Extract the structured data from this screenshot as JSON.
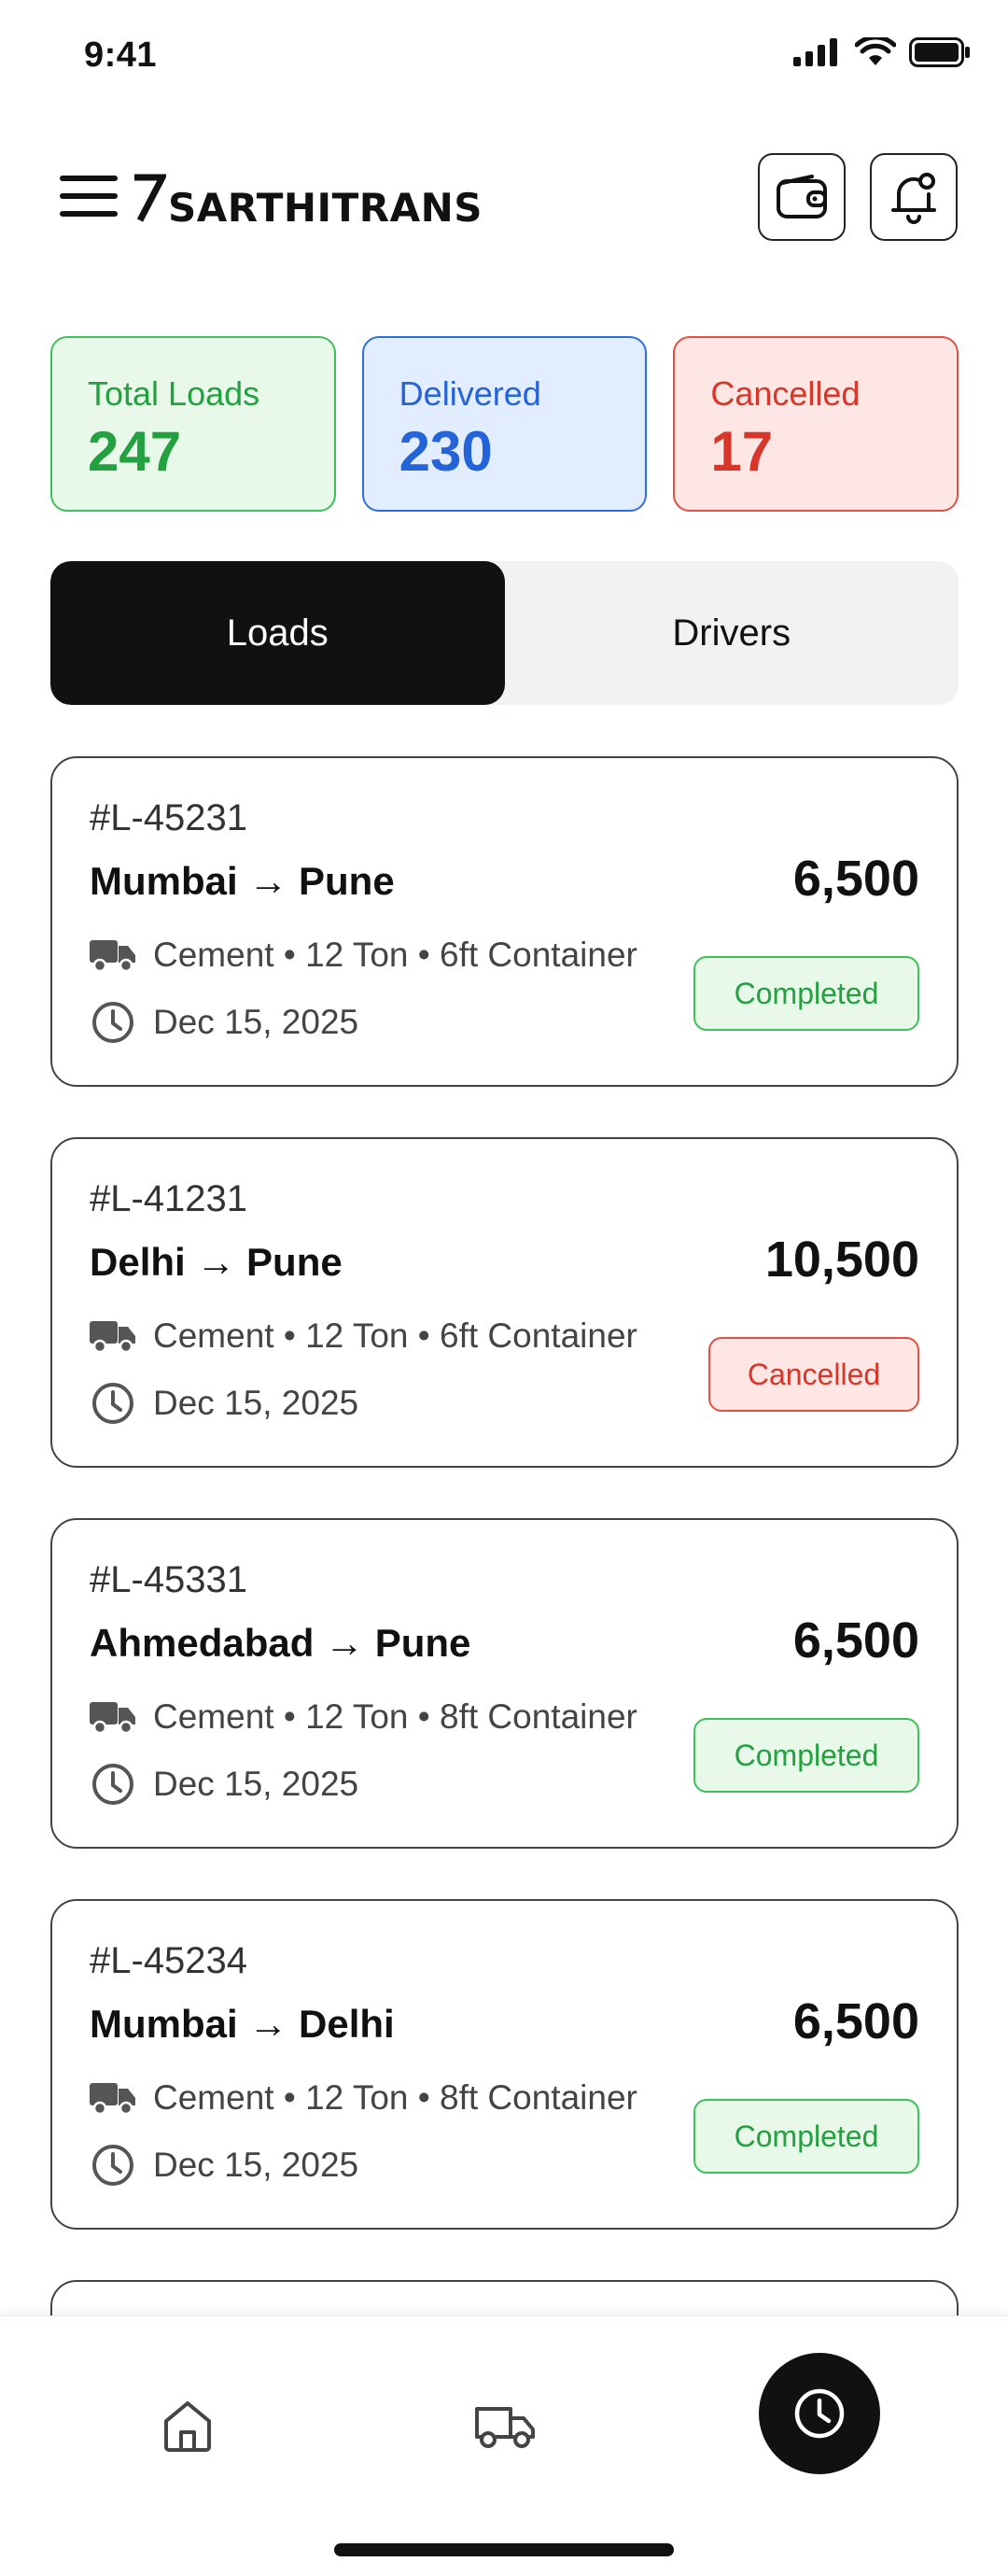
{
  "status_bar": {
    "time": "9:41"
  },
  "header": {
    "brand": "SARTHITRANS"
  },
  "stats": [
    {
      "label": "Total Loads",
      "value": "247"
    },
    {
      "label": "Delivered",
      "value": "230"
    },
    {
      "label": "Cancelled",
      "value": "17"
    }
  ],
  "tabs": {
    "loads": "Loads",
    "drivers": "Drivers",
    "active": "Loads"
  },
  "loads": [
    {
      "id": "#L-45231",
      "route": "Mumbai → Pune",
      "price": "6,500",
      "meta": "Cement • 12 Ton • 6ft Container",
      "date": "Dec 15, 2025",
      "status": "Completed"
    },
    {
      "id": "#L-41231",
      "route": "Delhi → Pune",
      "price": "10,500",
      "meta": "Cement • 12 Ton • 6ft Container",
      "date": "Dec 15, 2025",
      "status": "Cancelled"
    },
    {
      "id": "#L-45331",
      "route": "Ahmedabad → Pune",
      "price": "6,500",
      "meta": "Cement • 12 Ton • 8ft Container",
      "date": "Dec 15, 2025",
      "status": "Completed"
    },
    {
      "id": "#L-45234",
      "route": "Mumbai → Delhi",
      "price": "6,500",
      "meta": "Cement • 12 Ton • 8ft Container",
      "date": "Dec 15, 2025",
      "status": "Completed"
    }
  ],
  "colors": {
    "green": "#23a040",
    "blue": "#2563d9",
    "red": "#d9362a",
    "dark": "#111111"
  },
  "icons": {
    "menu": "hamburger-icon",
    "wallet": "wallet-icon",
    "bell": "bell-icon",
    "truck": "truck-icon",
    "clock": "clock-icon",
    "home": "home-icon",
    "history": "history-icon"
  }
}
